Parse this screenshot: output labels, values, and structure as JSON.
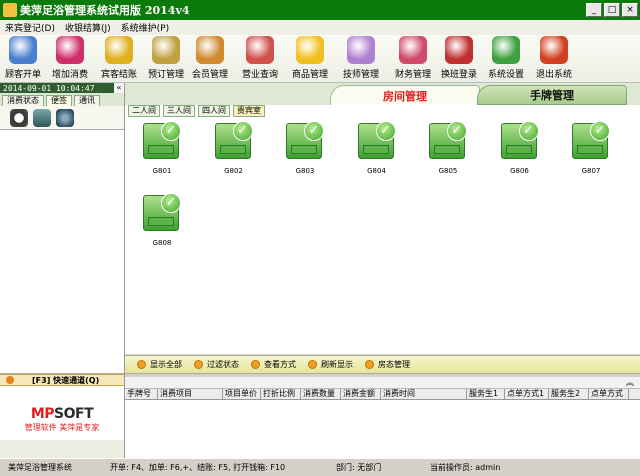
{
  "window": {
    "title": "美萍足浴管理系统试用版 2014v4"
  },
  "menu": [
    "来宾登记(D)",
    "收银结算(J)",
    "系统维护(P)"
  ],
  "toolbar": [
    {
      "label": "顾客开单",
      "icon": "open-bill-icon",
      "color": "#4a7fd0"
    },
    {
      "label": "增加消费",
      "icon": "add-consumption-icon",
      "color": "#d0306a"
    },
    {
      "label": "宾客结账",
      "icon": "checkout-icon",
      "color": "#e0b020"
    },
    {
      "label": "预订管理",
      "icon": "reservation-clock-icon",
      "color": "#c0a040"
    },
    {
      "label": "会员管理",
      "icon": "members-icon",
      "color": "#d08a30"
    },
    {
      "label": "营业查询",
      "icon": "business-query-icon",
      "color": "#d0504a"
    },
    {
      "label": "商品管理",
      "icon": "goods-star-icon",
      "color": "#f0c020"
    },
    {
      "label": "技师管理",
      "icon": "technician-icon",
      "color": "#b080d0"
    },
    {
      "label": "财务管理",
      "icon": "finance-icon",
      "color": "#d04a6a"
    },
    {
      "label": "换班登录",
      "icon": "shift-exit-icon",
      "color": "#c03030"
    },
    {
      "label": "系统设置",
      "icon": "settings-gear-icon",
      "color": "#40a040"
    },
    {
      "label": "退出系统",
      "icon": "exit-door-icon",
      "color": "#d04020"
    }
  ],
  "left": {
    "datetime": "2014-09-01 10:04:47",
    "tabs": [
      "消费状态",
      "便签",
      "通讯"
    ],
    "quick_access": "[F3] 快速通道(Q)",
    "logo_text_a": "MP",
    "logo_text_b": "SOFT",
    "logo_slogan": "管理软件 美萍是专家"
  },
  "main_tabs": {
    "active": "房间管理",
    "inactive": "手牌管理"
  },
  "room_types": [
    "二人间",
    "三人间",
    "四人间",
    "贵宾室"
  ],
  "rooms": [
    "G801",
    "G802",
    "G803",
    "G804",
    "G805",
    "G806",
    "G807",
    "G808"
  ],
  "actions": [
    "显示全部",
    "过滤状态",
    "查看方式",
    "刷新显示",
    "房态管理"
  ],
  "grid": {
    "columns": [
      "手牌号",
      "消费项目",
      "项目单价",
      "打折比例",
      "消费数量",
      "消费金额",
      "消费时间",
      "服务生1",
      "点单方式1",
      "服务生2",
      "点单方式"
    ]
  },
  "status": {
    "app": "美萍足浴管理系统",
    "hotkeys": "开单: F4、加单: F6,+、结账: F5, 打开钱箱: F10",
    "dept": "部门: 无部门",
    "operator": "当前操作员: admin"
  },
  "colors": {
    "title": "#0a7a0a",
    "accent_red": "#e02020",
    "room_green": "#3fa032"
  }
}
